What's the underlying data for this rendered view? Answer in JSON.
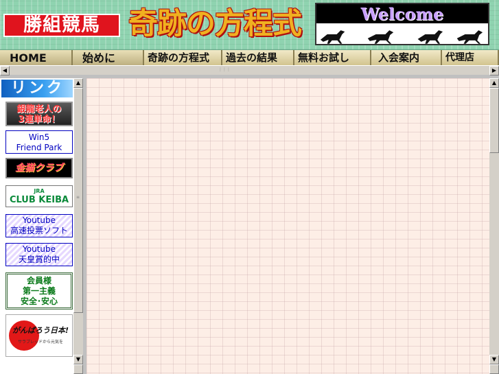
{
  "banner": {
    "logo_text": "勝組競馬",
    "title_text": "奇跡の方程式",
    "welcome_text": "Welcome"
  },
  "nav": {
    "items": [
      {
        "label": "HOME"
      },
      {
        "label": "始めに"
      },
      {
        "label": "奇跡の方程式"
      },
      {
        "label": "過去の結果"
      },
      {
        "label": "無料お試し"
      },
      {
        "label": "入会案内"
      },
      {
        "label": "代理店"
      }
    ]
  },
  "links": {
    "header": "リンク",
    "ginryu": {
      "line1": "銀龍老人の",
      "line2": "3連単命！"
    },
    "win5": {
      "line1": "Win5",
      "line2": "Friend Park"
    },
    "kinneko": "金猫クラブ",
    "jra": {
      "top": "JRA",
      "main": "CLUB KEIBA"
    },
    "yt1": {
      "line1": "Youtube",
      "line2": "高速投票ソフト"
    },
    "yt2": {
      "line1": "Youtube",
      "line2": "天皇賞的中"
    },
    "member": {
      "line1": "会員様",
      "line2": "第一主義",
      "line3": "安全･安心"
    },
    "ganbarou": {
      "main": "がんばろう日本!",
      "sub": "サラブレッドから元気を"
    }
  },
  "colors": {
    "banner_bg": "#8fd3b0",
    "logo_red": "#e0141e",
    "title_gold": "#f0b020",
    "content_bg": "#fdeee6",
    "link_blue": "#0000c0"
  }
}
